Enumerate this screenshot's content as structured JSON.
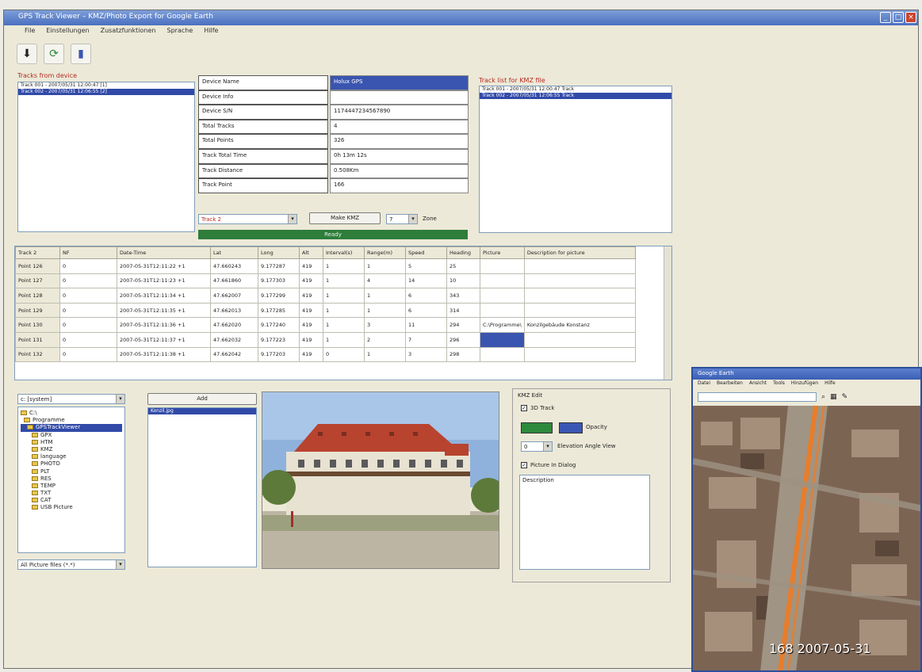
{
  "window": {
    "title": "GPS Track Viewer – KMZ/Photo Export for Google Earth",
    "menu": [
      "File",
      "Einstellungen",
      "Zusatzfunktionen",
      "Sprache",
      "Hilfe"
    ]
  },
  "toolbar": {
    "icons": [
      "download-icon",
      "refresh-icon",
      "device-icon"
    ]
  },
  "left_list": {
    "label": "Tracks from device",
    "items": [
      "Track 001 - 2007/05/31 12:00:47 [1]",
      "Track 002 - 2007/05/31 12:06:55 [2]"
    ],
    "selected": 1
  },
  "info": {
    "rows": [
      {
        "label": "Device Name",
        "value": "Holux GPS",
        "highlight": true
      },
      {
        "label": "Device Info",
        "value": ""
      },
      {
        "label": "Device S/N",
        "value": "1174447234567890"
      },
      {
        "label": "Total Tracks",
        "value": "4"
      },
      {
        "label": "Total Points",
        "value": "326"
      },
      {
        "label": "Track Total Time",
        "value": "0h 13m 12s"
      },
      {
        "label": "Track Distance",
        "value": "0.508Km"
      },
      {
        "label": "Track Point",
        "value": "166"
      }
    ],
    "track_select": "Track 2",
    "make_kmz": "Make KMZ",
    "zone_value": "7",
    "zone_label": "Zone",
    "status": "Ready"
  },
  "right_list": {
    "label": "Track list for KMZ file",
    "items": [
      "Track 001 - 2007/05/31 12:00:47 Track",
      "Track 002 - 2007/05/31 12:06:55 Track"
    ],
    "selected": 1
  },
  "table": {
    "headers": [
      "Track 2",
      "NF",
      "Date-Time",
      "Lat",
      "Long",
      "Alt",
      "Interval(s)",
      "Range(m)",
      "Speed",
      "Heading",
      "Picture",
      "Description for picture"
    ],
    "rows": [
      [
        "Point 126",
        "0",
        "2007-05-31T12:11:22 +1",
        "47.660243",
        "9.177287",
        "419",
        "1",
        "1",
        "5",
        "25",
        "",
        ""
      ],
      [
        "Point 127",
        "0",
        "2007-05-31T12:11:23 +1",
        "47.661860",
        "9.177303",
        "419",
        "1",
        "4",
        "14",
        "10",
        "",
        ""
      ],
      [
        "Point 128",
        "0",
        "2007-05-31T12:11:34 +1",
        "47.662007",
        "9.177299",
        "419",
        "1",
        "1",
        "6",
        "343",
        "",
        ""
      ],
      [
        "Point 129",
        "0",
        "2007-05-31T12:11:35 +1",
        "47.662013",
        "9.177285",
        "419",
        "1",
        "1",
        "6",
        "314",
        "",
        ""
      ],
      [
        "Point 130",
        "0",
        "2007-05-31T12:11:36 +1",
        "47.662020",
        "9.177240",
        "419",
        "1",
        "3",
        "11",
        "294",
        "C:\\Programme\\",
        "Konzilgebäude Konstanz"
      ],
      [
        "Point 131",
        "0",
        "2007-05-31T12:11:37 +1",
        "47.662032",
        "9.177223",
        "419",
        "1",
        "2",
        "7",
        "296",
        "",
        ""
      ],
      [
        "Point 132",
        "0",
        "2007-05-31T12:11:38 +1",
        "47.662042",
        "9.177203",
        "419",
        "0",
        "1",
        "3",
        "298",
        "",
        ""
      ]
    ]
  },
  "files": {
    "drive": "c: [system]",
    "tree": [
      "C:\\",
      "Programme",
      "GPSTrackViewer",
      "GPX",
      "HTM",
      "KMZ",
      "language",
      "PHOTO",
      "PLT",
      "RES",
      "TEMP",
      "TXT",
      "CAT",
      "USB Picture"
    ],
    "selected": 2,
    "filter": "All Picture files (*.*)",
    "add_button": "Add",
    "added_file": "Konzil.jpg"
  },
  "kmz_panel": {
    "title": "KMZ Edit",
    "track3d": "3D Track",
    "color1": "#2e8a3c",
    "color2": "#3b56b4",
    "opacity_label": "Opacity",
    "angle_value": "0",
    "angle_label": "Elevation Angle View",
    "picture_balloon": "Picture In Dialog",
    "description_label": "Description"
  },
  "earth": {
    "title": "Google Earth",
    "menu": [
      "Datei",
      "Bearbeiten",
      "Ansicht",
      "Tools",
      "Hinzufügen",
      "Hilfe"
    ],
    "overlay": "168 2007-05-31"
  }
}
